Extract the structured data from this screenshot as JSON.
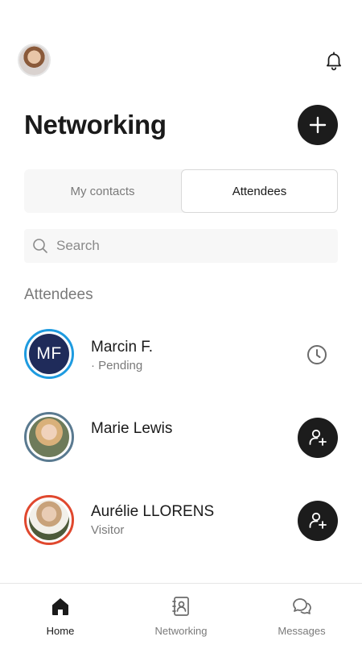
{
  "header": {
    "title": "Networking"
  },
  "segments": {
    "my_contacts": "My contacts",
    "attendees": "Attendees",
    "selected": "Attendees"
  },
  "search": {
    "placeholder": "Search",
    "value": ""
  },
  "section_title": "Attendees",
  "attendees": [
    {
      "name": "Marcin F.",
      "subtitle": "· Pending",
      "initials": "MF",
      "ring_color": "#1e9be0",
      "action": "clock-icon"
    },
    {
      "name": "Marie Lewis",
      "subtitle": "",
      "initials": "",
      "ring_color": "#5a7a90",
      "action": "add-contact-icon"
    },
    {
      "name": "Aurélie LLORENS",
      "subtitle": "Visitor",
      "initials": "",
      "ring_color": "#e0482e",
      "action": "add-contact-icon"
    }
  ],
  "tabbar": {
    "items": [
      {
        "label": "Home",
        "icon": "home-icon",
        "active": true
      },
      {
        "label": "Networking",
        "icon": "contacts-book-icon",
        "active": false
      },
      {
        "label": "Messages",
        "icon": "chat-bubbles-icon",
        "active": false
      }
    ]
  },
  "colors": {
    "accent_dark": "#1c1c1c",
    "initials_bg": "#1f2b5a"
  }
}
